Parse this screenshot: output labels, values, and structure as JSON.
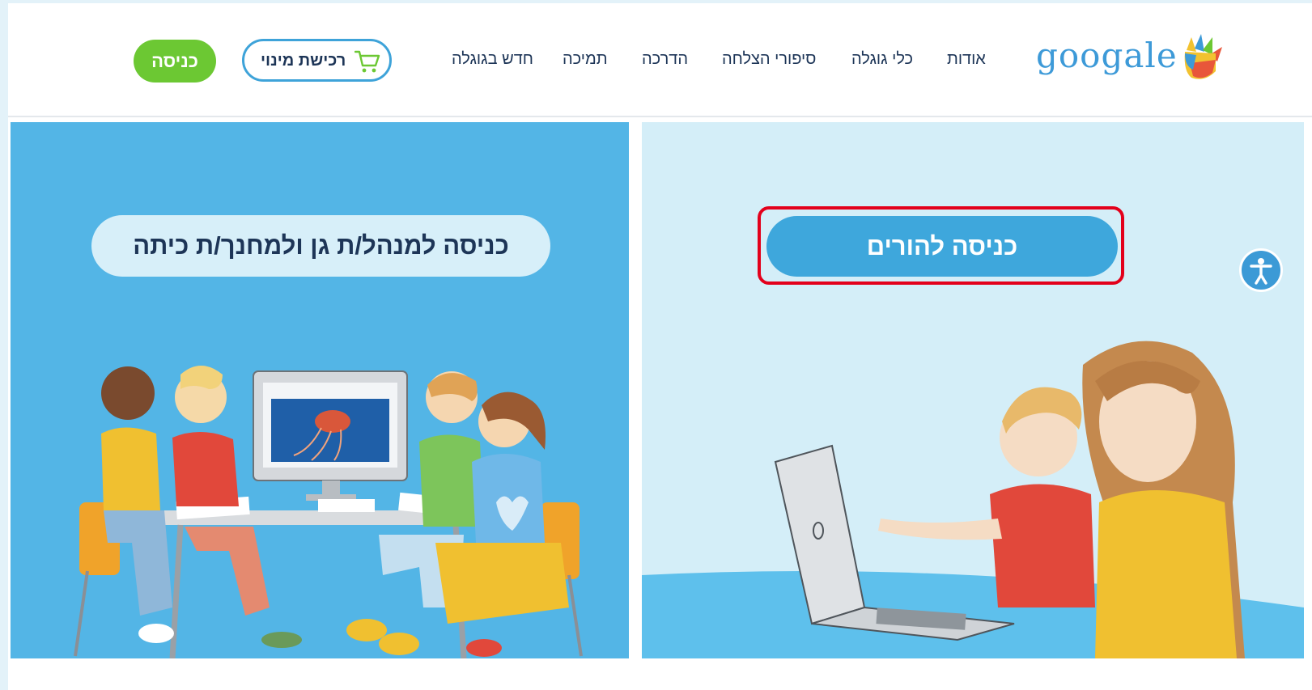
{
  "header": {
    "logo_text": "googale",
    "nav": {
      "about": "אודות",
      "tools": "כלי גוגלה",
      "stories": "סיפורי הצלחה",
      "training": "הדרכה",
      "support": "תמיכה",
      "news": "חדש בגוגלה"
    },
    "buy_label": "רכישת מינוי",
    "login_label": "כניסה"
  },
  "panels": {
    "teacher_label": "כניסה למנהל/ת גן ולמחנך/ת כיתה",
    "parents_label": "כניסה להורים"
  },
  "icons": {
    "cart": "cart-icon",
    "accessibility": "accessibility-icon",
    "logo_hand": "hand-logo-icon"
  },
  "colors": {
    "brand_blue": "#3ea3d9",
    "login_green": "#6cc833",
    "panel_left_bg": "#53b5e6",
    "panel_right_bg": "#d4eef8",
    "nav_text": "#1d3557",
    "highlight_red": "#e3001b"
  }
}
